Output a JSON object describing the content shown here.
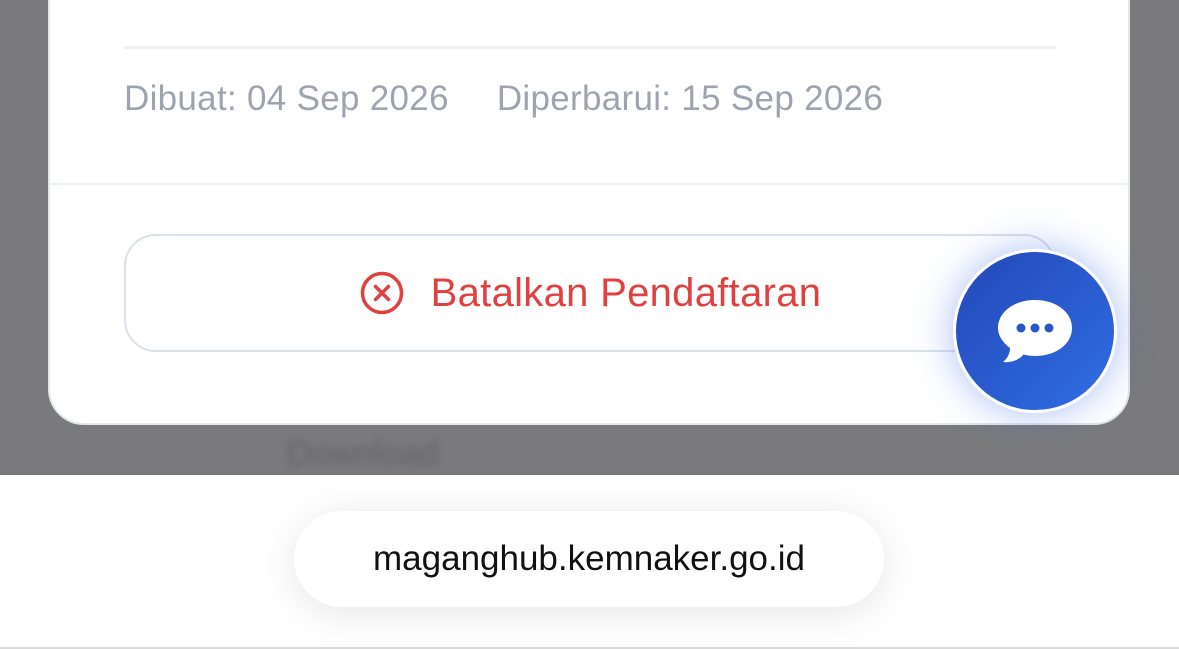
{
  "card": {
    "created_label": "Dibuat: 04 Sep 2026",
    "updated_label": "Diperbarui: 15 Sep 2026",
    "cancel_button_label": "Batalkan Pendaftaran",
    "cancel_icon": "close-circle-icon",
    "accent_danger": "#e0403f"
  },
  "background": {
    "obscured_text": "Download"
  },
  "chat": {
    "icon": "chat-bubble-dots-icon",
    "color": "#2f6ee3"
  },
  "browser": {
    "url": "maganghub.kemnaker.go.id"
  }
}
